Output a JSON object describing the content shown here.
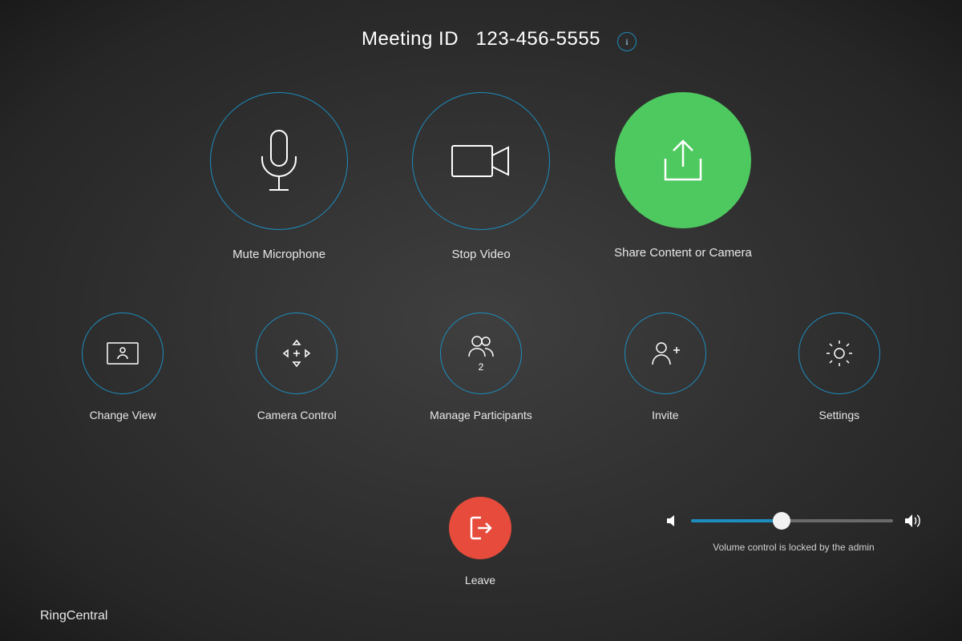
{
  "header": {
    "meeting_id_label": "Meeting ID",
    "meeting_id_value": "123-456-5555"
  },
  "primary": {
    "mute": {
      "label": "Mute Microphone"
    },
    "video": {
      "label": "Stop Video"
    },
    "share": {
      "label": "Share Content or Camera"
    }
  },
  "secondary": {
    "change_view": {
      "label": "Change View"
    },
    "camera_control": {
      "label": "Camera Control"
    },
    "participants": {
      "label": "Manage Participants",
      "count": "2"
    },
    "invite": {
      "label": "Invite"
    },
    "settings": {
      "label": "Settings"
    }
  },
  "leave": {
    "label": "Leave"
  },
  "volume": {
    "note": "Volume control is locked by the admin",
    "percent": 45
  },
  "brand": "RingCentral",
  "colors": {
    "accent": "#1d8dbf",
    "green": "#4ec960",
    "red": "#e64b3c"
  }
}
